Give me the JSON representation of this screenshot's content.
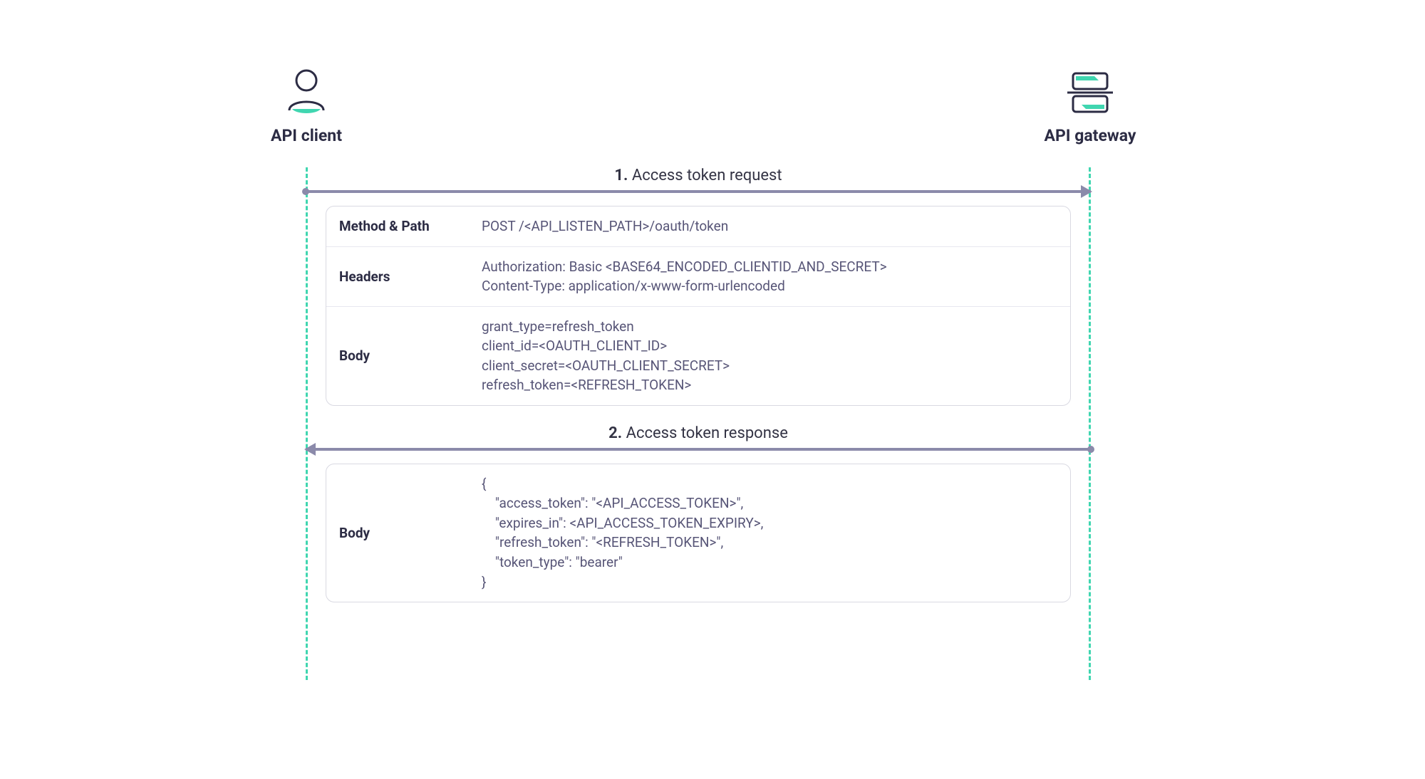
{
  "actors": {
    "client_label": "API client",
    "gateway_label": "API gateway"
  },
  "steps": {
    "request": {
      "number": "1.",
      "title": "Access token request",
      "method_path_label": "Method & Path",
      "method_path_value": "POST /<API_LISTEN_PATH>/oauth/token",
      "headers_label": "Headers",
      "headers_value": "Authorization: Basic <BASE64_ENCODED_CLIENTID_AND_SECRET>\nContent-Type: application/x-www-form-urlencoded",
      "body_label": "Body",
      "body_value": "grant_type=refresh_token\nclient_id=<OAUTH_CLIENT_ID>\nclient_secret=<OAUTH_CLIENT_SECRET>\nrefresh_token=<REFRESH_TOKEN>"
    },
    "response": {
      "number": "2.",
      "title": "Access token response",
      "body_label": "Body",
      "body_value": "{\n    \"access_token\": \"<API_ACCESS_TOKEN>\",\n    \"expires_in\": <API_ACCESS_TOKEN_EXPIRY>,\n    \"refresh_token\": \"<REFRESH_TOKEN>\",\n    \"token_type\": \"bearer\"\n}"
    }
  },
  "colors": {
    "lifeline": "#40d6b0",
    "arrow": "#8b8aaa",
    "text_primary": "#2c2c44",
    "text_value": "#575577",
    "border": "#d9d9e2"
  }
}
